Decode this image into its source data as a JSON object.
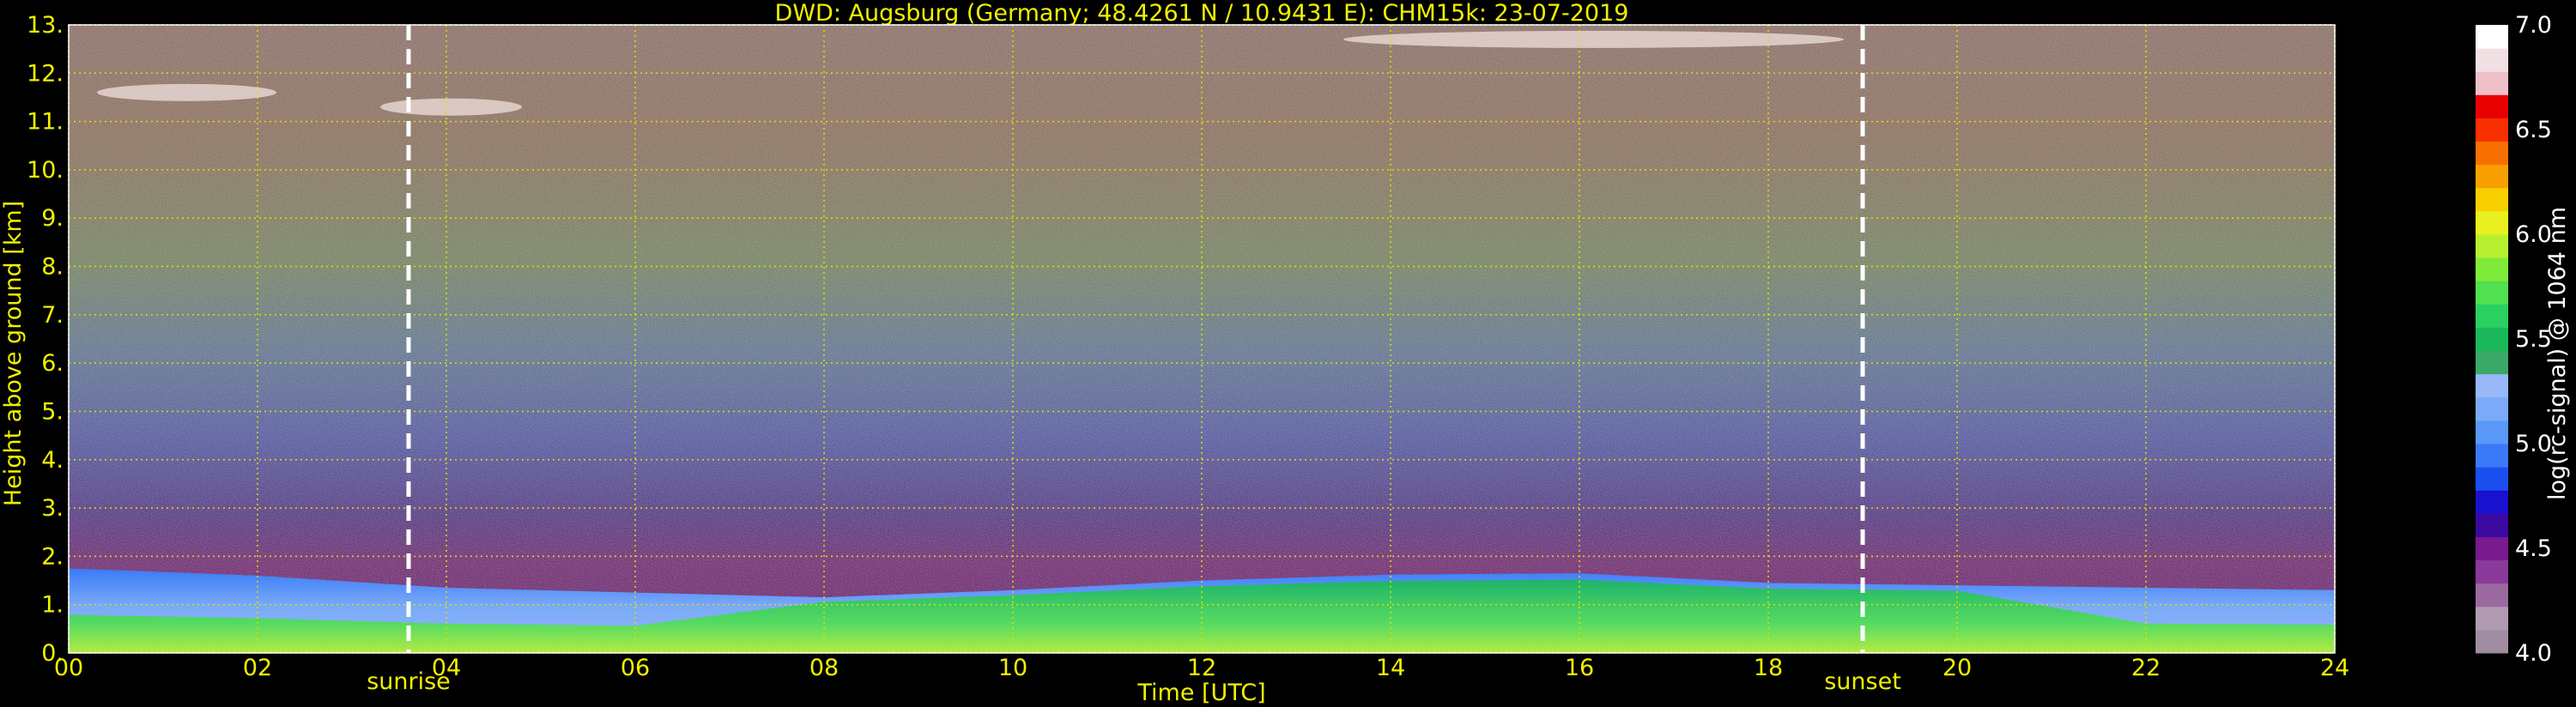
{
  "chart_data": {
    "type": "heatmap",
    "title": "DWD: Augsburg (Germany; 48.4261 N / 10.9431 E):    CHM15k: 23-07-2019",
    "xlabel": "Time [UTC]",
    "ylabel": "Height above ground [km]",
    "xlim": [
      0,
      24
    ],
    "ylim": [
      0,
      13
    ],
    "x_ticks": [
      "00",
      "02",
      "04",
      "06",
      "08",
      "10",
      "12",
      "14",
      "16",
      "18",
      "20",
      "22",
      "24"
    ],
    "y_ticks": [
      "0.",
      "1.",
      "2.",
      "3.",
      "4.",
      "5.",
      "6.",
      "7.",
      "8.",
      "9.",
      "10.",
      "11.",
      "12.",
      "13."
    ],
    "grid": true,
    "annotations": [
      {
        "label": "sunrise",
        "x": 3.6
      },
      {
        "label": "sunset",
        "x": 19.0
      }
    ],
    "colorbar": {
      "label": "log(rc-signal) @ 1064 nm",
      "min": 4.0,
      "max": 7.0,
      "ticks": [
        "4.0",
        "4.5",
        "5.0",
        "5.5",
        "6.0",
        "6.5",
        "7.0"
      ],
      "colors": [
        "#a08ca0",
        "#b09ab0",
        "#9a6aa0",
        "#8a3a9a",
        "#7a1a90",
        "#3a0aa0",
        "#1a10d0",
        "#1a50f0",
        "#3a7af8",
        "#5a98f8",
        "#7aaaf8",
        "#98b8f8",
        "#3aa868",
        "#1ab85a",
        "#2ad060",
        "#50e050",
        "#80ea3a",
        "#b8f030",
        "#e8f020",
        "#f8d000",
        "#f8a000",
        "#f87000",
        "#f83000",
        "#e80000",
        "#f0c0c8",
        "#f0e0e4",
        "#ffffff"
      ]
    },
    "boundary_layer_top_km": [
      {
        "x": 0,
        "y": 1.75
      },
      {
        "x": 2,
        "y": 1.6
      },
      {
        "x": 4,
        "y": 1.35
      },
      {
        "x": 6,
        "y": 1.25
      },
      {
        "x": 8,
        "y": 1.15
      },
      {
        "x": 10,
        "y": 1.3
      },
      {
        "x": 12,
        "y": 1.5
      },
      {
        "x": 14,
        "y": 1.62
      },
      {
        "x": 16,
        "y": 1.65
      },
      {
        "x": 18,
        "y": 1.45
      },
      {
        "x": 20,
        "y": 1.4
      },
      {
        "x": 22,
        "y": 1.35
      },
      {
        "x": 24,
        "y": 1.3
      }
    ],
    "cloud_segments": [
      {
        "x0": 0.3,
        "x1": 2.2,
        "y": 11.6
      },
      {
        "x0": 3.3,
        "x1": 4.8,
        "y": 11.3
      },
      {
        "x0": 13.5,
        "x1": 18.8,
        "y": 12.7
      }
    ],
    "colors": {
      "background": "#000000",
      "text": "#f0f000",
      "grid": "#e0e000",
      "marker": "#ffffff"
    }
  }
}
